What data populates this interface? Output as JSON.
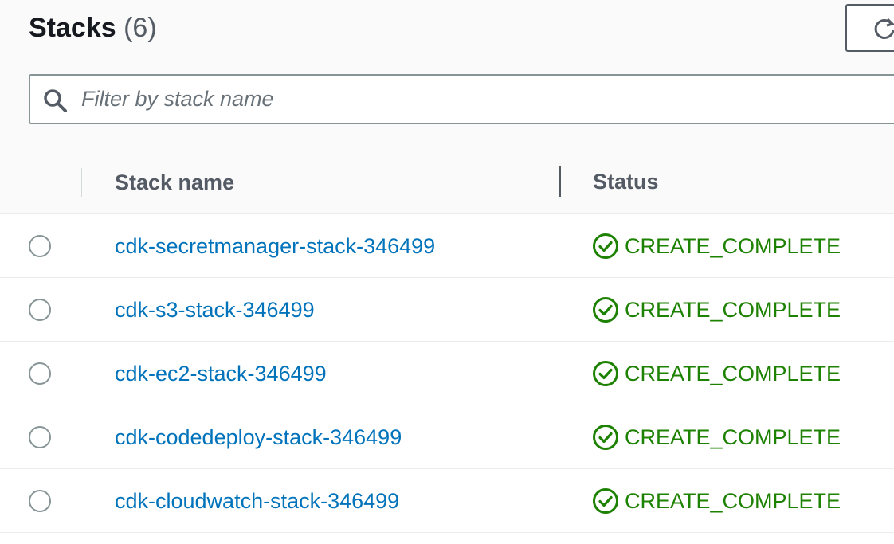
{
  "header": {
    "title": "Stacks",
    "count": "(6)",
    "refresh_icon": "refresh-icon"
  },
  "search": {
    "placeholder": "Filter by stack name",
    "value": "",
    "icon": "search-icon"
  },
  "table": {
    "columns": [
      "Stack name",
      "Status"
    ],
    "rows": [
      {
        "name": "cdk-secretmanager-stack-346499",
        "status": "CREATE_COMPLETE"
      },
      {
        "name": "cdk-s3-stack-346499",
        "status": "CREATE_COMPLETE"
      },
      {
        "name": "cdk-ec2-stack-346499",
        "status": "CREATE_COMPLETE"
      },
      {
        "name": "cdk-codedeploy-stack-346499",
        "status": "CREATE_COMPLETE"
      },
      {
        "name": "cdk-cloudwatch-stack-346499",
        "status": "CREATE_COMPLETE"
      }
    ]
  },
  "colors": {
    "link": "#0073bb",
    "success": "#1d8102",
    "heading": "#16191f",
    "header_text": "#545b64"
  }
}
